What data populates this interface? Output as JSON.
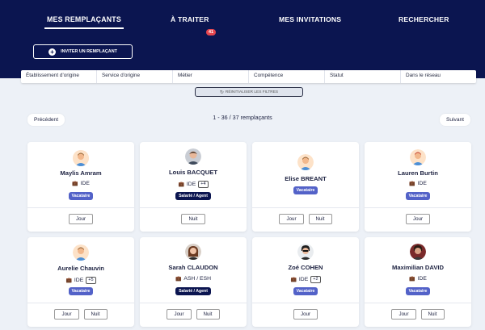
{
  "nav": {
    "tabs": [
      {
        "label": "MES REMPLAÇANTS"
      },
      {
        "label": "À TRAITER",
        "badge": "41"
      },
      {
        "label": "MES INVITATIONS"
      },
      {
        "label": "RECHERCHER"
      }
    ]
  },
  "invite": {
    "label": "INVITER UN REMPLAÇANT"
  },
  "filters": [
    "Établissement d'origine",
    "Service d'origine",
    "Métier",
    "Compétence",
    "Statut",
    "Dans le réseau"
  ],
  "reset": {
    "label": "RÉINITIALISER LES FILTRES"
  },
  "pagination": {
    "prev": "Précédent",
    "next": "Suivant",
    "count": "1 - 36 / 37 remplaçants"
  },
  "cards": [
    {
      "name": "Maylis Amram",
      "job": "IDE",
      "extra": "",
      "status": "Vacataire",
      "shifts": [
        "Jour"
      ]
    },
    {
      "name": "Louis BACQUET",
      "job": "IDE",
      "extra": "+4",
      "status": "Salarié / Agent",
      "shifts": [
        "Nuit"
      ]
    },
    {
      "name": "Elise BREANT",
      "job": "",
      "extra": "",
      "status": "Vacataire",
      "shifts": [
        "Jour",
        "Nuit"
      ]
    },
    {
      "name": "Lauren Burtin",
      "job": "IDE",
      "extra": "",
      "status": "Vacataire",
      "shifts": [
        "Jour"
      ]
    },
    {
      "name": "Aurelie Chauvin",
      "job": "IDE",
      "extra": "+5",
      "status": "Vacataire",
      "shifts": [
        "Jour",
        "Nuit"
      ]
    },
    {
      "name": "Sarah CLAUDON",
      "job": "ASH / ESH",
      "extra": "",
      "status": "Salarié / Agent",
      "shifts": [
        "Jour",
        "Nuit"
      ]
    },
    {
      "name": "Zoé COHEN",
      "job": "IDE",
      "extra": "+2",
      "status": "Vacataire",
      "shifts": [
        "Jour"
      ]
    },
    {
      "name": "Maximilian DAVID",
      "job": "IDE",
      "extra": "",
      "status": "Vacataire",
      "shifts": [
        "Jour",
        "Nuit"
      ]
    }
  ]
}
